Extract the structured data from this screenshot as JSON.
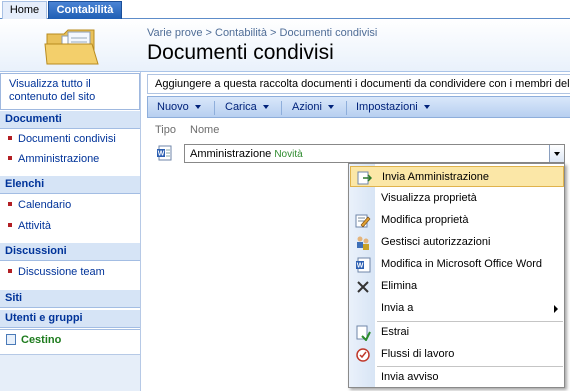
{
  "tabs": {
    "home": "Home",
    "active": "Contabilità"
  },
  "header": {
    "breadcrumb": [
      "Varie prove",
      "Contabilità",
      "Documenti condivisi"
    ],
    "breadcrumb_sep": ">",
    "title": "Documenti condivisi"
  },
  "leftnav": {
    "view_all": "Visualizza tutto il contenuto del sito",
    "sections": [
      {
        "title": "Documenti",
        "items": [
          "Documenti condivisi",
          "Amministrazione"
        ]
      },
      {
        "title": "Elenchi",
        "items": [
          "Calendario",
          "Attività"
        ]
      },
      {
        "title": "Discussioni",
        "items": [
          "Discussione team"
        ]
      },
      {
        "title": "Siti",
        "items": []
      },
      {
        "title": "Utenti e gruppi",
        "items": []
      }
    ],
    "recycle": "Cestino"
  },
  "main": {
    "description": "Aggiungere a questa raccolta documenti i documenti da condividere con i membri del tea",
    "toolbar": [
      "Nuovo",
      "Carica",
      "Azioni",
      "Impostazioni"
    ],
    "columns": {
      "type": "Tipo",
      "name": "Nome"
    },
    "row": {
      "name": "Amministrazione",
      "badge": "Novità"
    }
  },
  "menu": {
    "items": [
      {
        "label": "Invia Amministrazione",
        "icon": "send-icon",
        "highlighted": true
      },
      {
        "label": "Visualizza proprietà",
        "icon": ""
      },
      {
        "label": "Modifica proprietà",
        "icon": "edit-properties-icon"
      },
      {
        "label": "Gestisci autorizzazioni",
        "icon": "permissions-icon"
      },
      {
        "label": "Modifica in Microsoft Office Word",
        "icon": "word-icon"
      },
      {
        "label": "Elimina",
        "icon": "delete-icon"
      },
      {
        "label": "Invia a",
        "icon": "",
        "submenu": true
      },
      {
        "label": "Estrai",
        "icon": "checkout-icon"
      },
      {
        "label": "Flussi di lavoro",
        "icon": "workflow-icon"
      },
      {
        "label": "Invia avviso",
        "icon": ""
      }
    ]
  },
  "colors": {
    "accent": "#1f5fb4",
    "link": "#003399",
    "highlight": "#fbe7a7"
  }
}
